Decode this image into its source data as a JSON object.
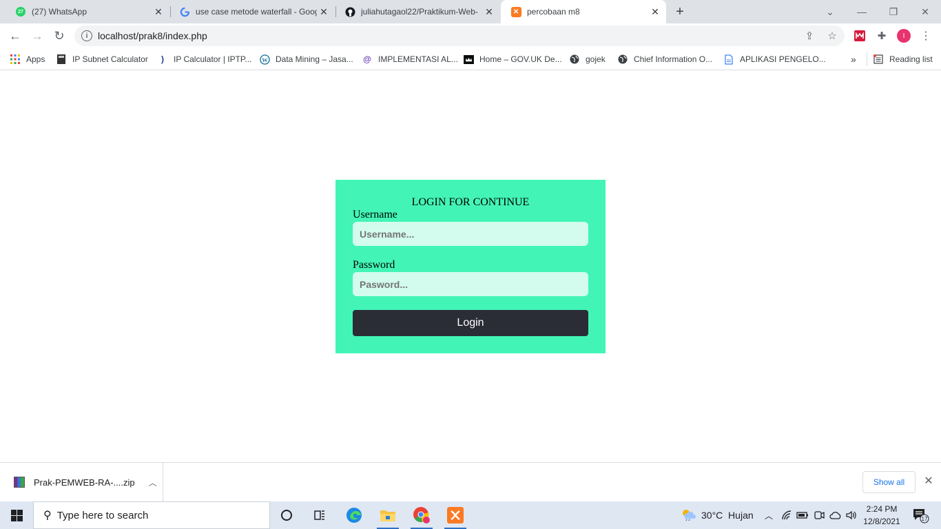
{
  "tabs": [
    {
      "title": "(27) WhatsApp",
      "badge": "27"
    },
    {
      "title": "use case metode waterfall - Goog"
    },
    {
      "title": "juliahutagaol22/Praktikum-Web-"
    },
    {
      "title": "percobaan m8"
    }
  ],
  "address": {
    "url": "localhost/prak8/index.php"
  },
  "profile_initial": "I",
  "bookmarks": {
    "apps": "Apps",
    "items": [
      "IP Subnet Calculator",
      "IP Calculator | IPTP...",
      "Data Mining – Jasa...",
      "IMPLEMENTASI AL...",
      "Home – GOV.UK De...",
      "gojek",
      "Chief Information O...",
      "APLIKASI PENGELO..."
    ],
    "overflow": "»",
    "reading_list": "Reading list"
  },
  "login": {
    "title": "LOGIN FOR CONTINUE",
    "username_label": "Username",
    "username_placeholder": "Username...",
    "password_label": "Password",
    "password_placeholder": "Pasword...",
    "button": "Login"
  },
  "downloads": {
    "filename": "Prak-PEMWEB-RA-....zip",
    "show_all": "Show all"
  },
  "taskbar": {
    "search_placeholder": "Type here to search",
    "weather": "30°C  Hujan",
    "time": "2:24 PM",
    "date": "12/8/2021",
    "notification_count": "17"
  }
}
